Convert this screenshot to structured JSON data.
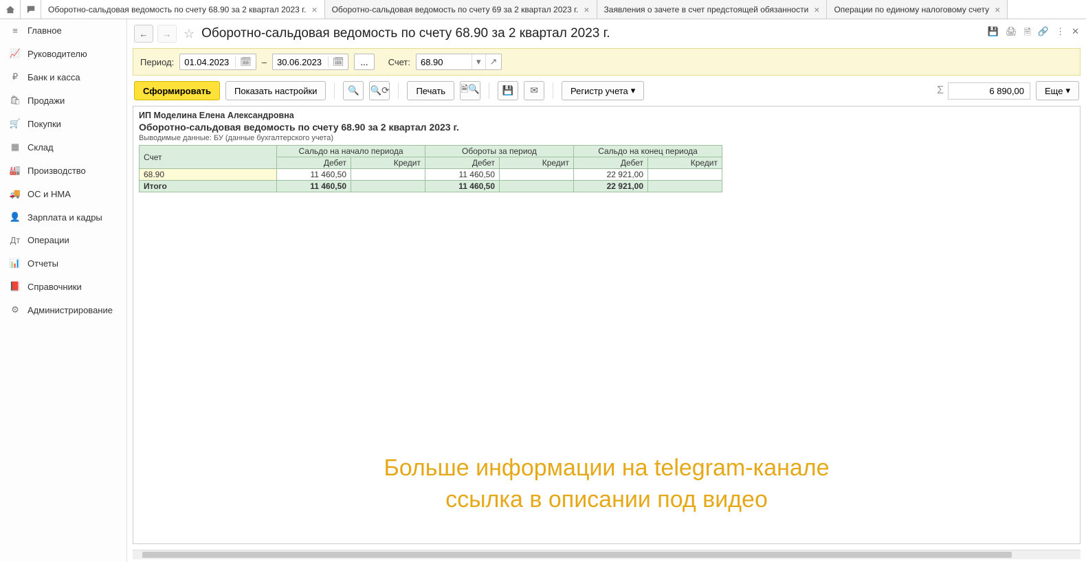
{
  "tabs": [
    {
      "label": "Оборотно-сальдовая ведомость по счету 68.90 за 2 квартал 2023 г.",
      "active": true
    },
    {
      "label": "Оборотно-сальдовая ведомость по счету 69 за 2 квартал 2023 г.",
      "active": false
    },
    {
      "label": "Заявления о зачете в счет предстоящей обязанности",
      "active": false
    },
    {
      "label": "Операции по единому налоговому счету",
      "active": false
    }
  ],
  "sidebar": [
    {
      "icon": "≡",
      "label": "Главное",
      "name": "sidebar-item-main"
    },
    {
      "icon": "📈",
      "label": "Руководителю",
      "name": "sidebar-item-manager"
    },
    {
      "icon": "₽",
      "label": "Банк и касса",
      "name": "sidebar-item-bank"
    },
    {
      "icon": "🛍",
      "label": "Продажи",
      "name": "sidebar-item-sales"
    },
    {
      "icon": "🛒",
      "label": "Покупки",
      "name": "sidebar-item-purchases"
    },
    {
      "icon": "▦",
      "label": "Склад",
      "name": "sidebar-item-warehouse"
    },
    {
      "icon": "🏭",
      "label": "Производство",
      "name": "sidebar-item-production"
    },
    {
      "icon": "🚚",
      "label": "ОС и НМА",
      "name": "sidebar-item-assets"
    },
    {
      "icon": "👤",
      "label": "Зарплата и кадры",
      "name": "sidebar-item-hr"
    },
    {
      "icon": "Дт",
      "label": "Операции",
      "name": "sidebar-item-operations"
    },
    {
      "icon": "📊",
      "label": "Отчеты",
      "name": "sidebar-item-reports"
    },
    {
      "icon": "📕",
      "label": "Справочники",
      "name": "sidebar-item-catalogs"
    },
    {
      "icon": "⚙",
      "label": "Администрирование",
      "name": "sidebar-item-admin"
    }
  ],
  "page": {
    "title": "Оборотно-сальдовая ведомость по счету 68.90 за 2 квартал 2023 г."
  },
  "params": {
    "period_label": "Период:",
    "date_from": "01.04.2023",
    "dash": "–",
    "date_to": "30.06.2023",
    "ellipsis": "...",
    "account_label": "Счет:",
    "account": "68.90"
  },
  "toolbar": {
    "form": "Сформировать",
    "settings": "Показать настройки",
    "print": "Печать",
    "register": "Регистр учета",
    "more": "Еще",
    "sum": "6 890,00"
  },
  "report": {
    "org": "ИП Моделина Елена Александровна",
    "title": "Оборотно-сальдовая ведомость по счету 68.90 за 2 квартал 2023 г.",
    "sub": "Выводимые данные: БУ (данные бухгалтерского учета)",
    "headers": {
      "account": "Счет",
      "start": "Сальдо на начало периода",
      "turns": "Обороты за период",
      "end": "Сальдо на конец периода",
      "debit": "Дебет",
      "credit": "Кредит"
    },
    "rows": [
      {
        "acct": "68.90",
        "start_d": "11 460,50",
        "start_c": "",
        "turn_d": "11 460,50",
        "turn_c": "",
        "end_d": "22 921,00",
        "end_c": ""
      }
    ],
    "total": {
      "label": "Итого",
      "start_d": "11 460,50",
      "start_c": "",
      "turn_d": "11 460,50",
      "turn_c": "",
      "end_d": "22 921,00",
      "end_c": ""
    }
  },
  "watermark": {
    "line1": "Больше информации на telegram-канале",
    "line2": "ссылка в описании под видео"
  }
}
